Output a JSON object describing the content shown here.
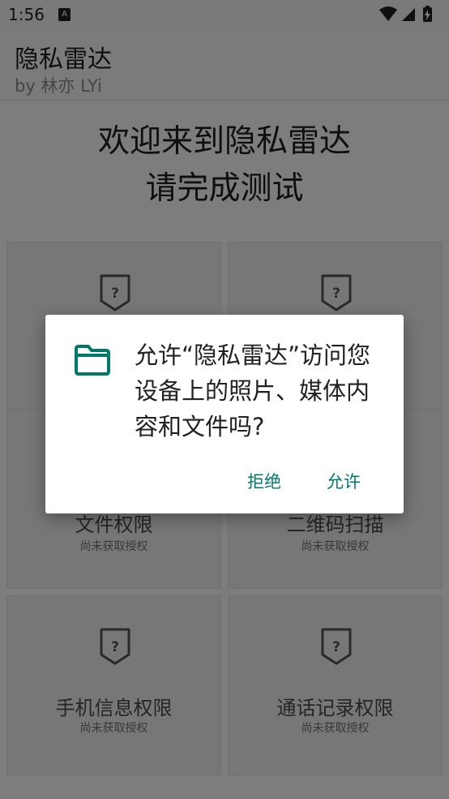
{
  "status_bar": {
    "time": "1:56",
    "notification_glyph": "A",
    "icons": [
      "wifi-icon",
      "cell-signal-icon",
      "battery-charging-icon"
    ]
  },
  "app_bar": {
    "title": "隐私雷达",
    "subtitle": "by 林亦 LYi"
  },
  "welcome": {
    "line1": "欢迎来到隐私雷达",
    "line2": "请完成测试"
  },
  "tiles": [
    {
      "label": "",
      "status": "",
      "icon": "shield-question-icon"
    },
    {
      "label": "",
      "status": "",
      "icon": "shield-question-icon"
    },
    {
      "label": "文件权限",
      "status": "尚未获取授权",
      "icon": "shield-question-icon"
    },
    {
      "label": "二维码扫描",
      "status": "尚未获取授权",
      "icon": "shield-question-icon"
    },
    {
      "label": "手机信息权限",
      "status": "尚未获取授权",
      "icon": "shield-question-icon"
    },
    {
      "label": "通话记录权限",
      "status": "尚未获取授权",
      "icon": "shield-question-icon"
    }
  ],
  "dialog": {
    "icon": "folder-icon",
    "message": "允许“隐私雷达”访问您设备上的照片、媒体内容和文件吗?",
    "deny_label": "拒绝",
    "allow_label": "允许",
    "accent_color": "#00796b"
  }
}
